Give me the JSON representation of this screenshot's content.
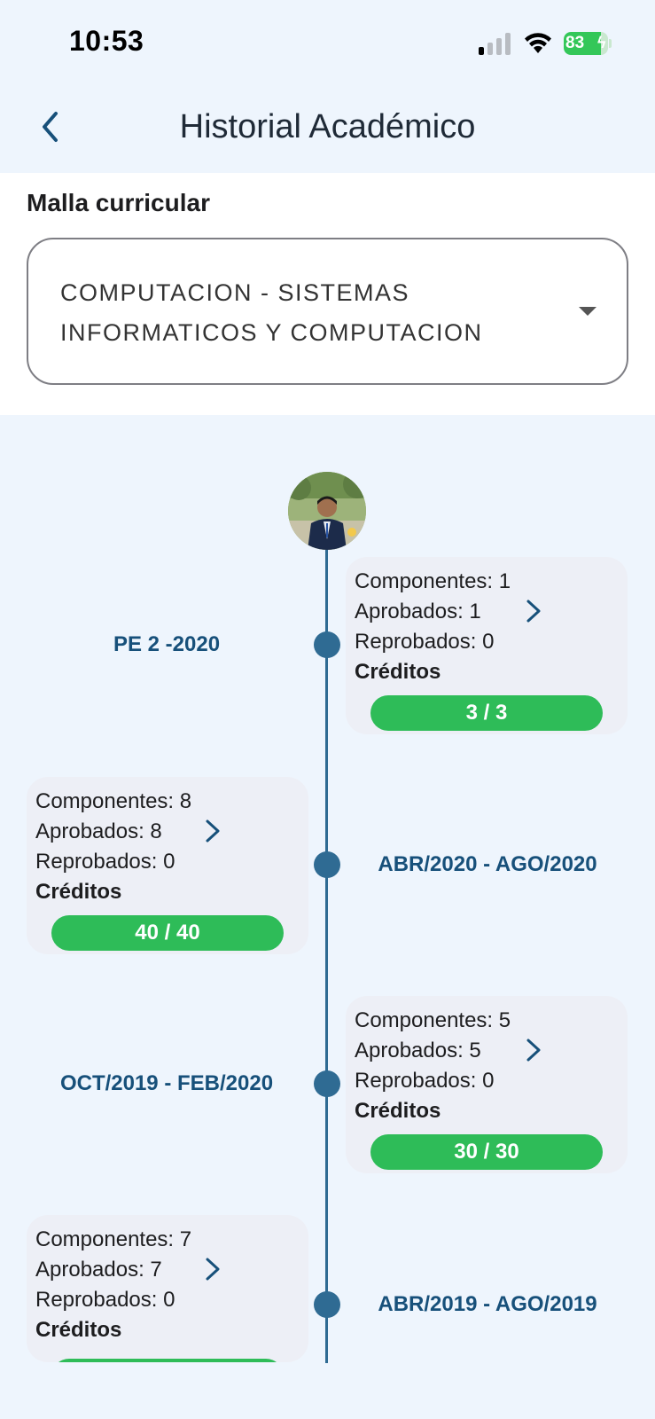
{
  "status_bar": {
    "time": "10:53",
    "battery_level": "83",
    "battery_fraction": 0.83,
    "signal_bars_active": 1
  },
  "nav": {
    "title": "Historial Académico",
    "back_icon": "chevron-left-icon"
  },
  "curriculum": {
    "label": "Malla curricular",
    "selected_value": "COMPUTACION - SISTEMAS INFORMATICOS Y COMPUTACION",
    "dropdown_icon": "caret-down-icon"
  },
  "timeline": {
    "entries": [
      {
        "period": "PE 2 -2020",
        "componentes": "Componentes: 1",
        "aprobados": "Aprobados: 1",
        "reprobados": "Reprobados: 0",
        "creditos_label": "Créditos",
        "creditos_value": "3 / 3"
      },
      {
        "period": "ABR/2020 - AGO/2020",
        "componentes": "Componentes: 8",
        "aprobados": "Aprobados: 8",
        "reprobados": "Reprobados: 0",
        "creditos_label": "Créditos",
        "creditos_value": "40 / 40"
      },
      {
        "period": "OCT/2019 - FEB/2020",
        "componentes": "Componentes: 5",
        "aprobados": "Aprobados: 5",
        "reprobados": "Reprobados: 0",
        "creditos_label": "Créditos",
        "creditos_value": "30 / 30"
      },
      {
        "period": "ABR/2019 - AGO/2019",
        "componentes": "Componentes: 7",
        "aprobados": "Aprobados: 7",
        "reprobados": "Reprobados: 0",
        "creditos_label": "Créditos",
        "creditos_value": ""
      }
    ]
  },
  "colors": {
    "background": "#eef5fd",
    "accent": "#17507a",
    "timeline": "#2f6b93",
    "credits_bar": "#2ebc58",
    "card": "#edeff6"
  }
}
